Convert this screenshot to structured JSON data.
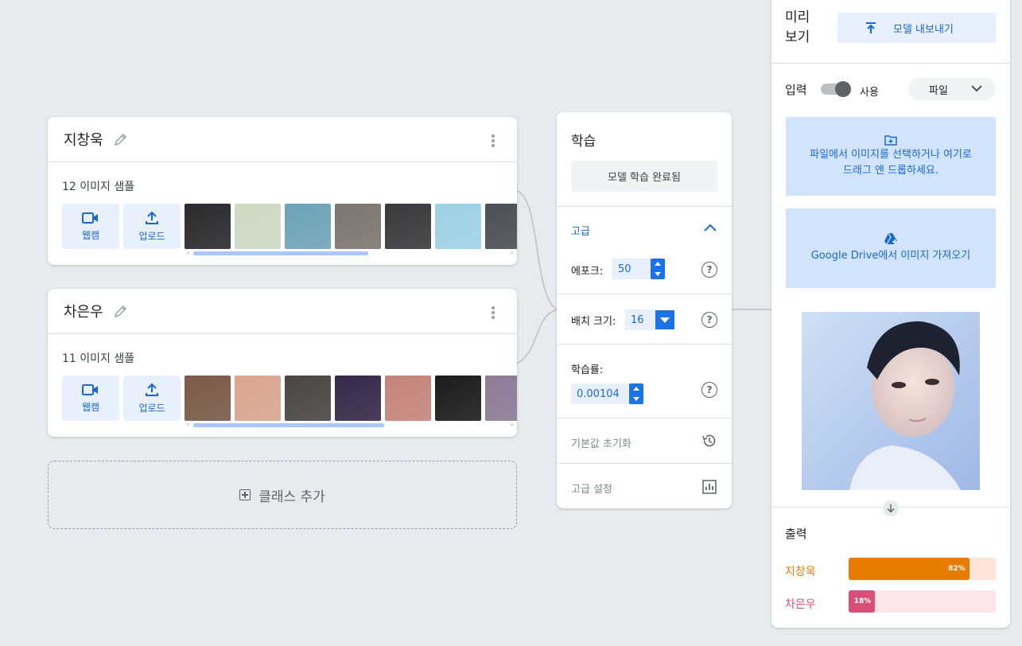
{
  "classes": [
    {
      "name": "지창욱",
      "samples_label": "12 이미지 샘플",
      "webcam_label": "웹캠",
      "upload_label": "업로드",
      "thumb_colors": [
        "#2b2b2e",
        "#cfd9c4",
        "#6fa3b8",
        "#7d7670",
        "#3a3a3c",
        "#9fd1e6",
        "#4d4f55"
      ]
    },
    {
      "name": "차은우",
      "samples_label": "11 이미지 샘플",
      "webcam_label": "웹캠",
      "upload_label": "업로드",
      "thumb_colors": [
        "#7a5a4a",
        "#d9a58f",
        "#4a4644",
        "#352a48",
        "#c4857a",
        "#1c1c1c",
        "#8c7c96"
      ]
    }
  ],
  "add_class_label": "클래스 추가",
  "training": {
    "title": "학습",
    "train_button": "모델 학습 완료됨",
    "advanced_label": "고급",
    "epochs_label": "에포크:",
    "epochs_value": "50",
    "batch_label": "배치 크기:",
    "batch_value": "16",
    "lr_label": "학습률:",
    "lr_value": "0.00104",
    "reset_label": "기본값 초기화",
    "advanced_settings_label": "고급 설정",
    "help_glyph": "?"
  },
  "preview": {
    "title": "미리보기",
    "export_label": "모델 내보내기",
    "input_label": "입력",
    "toggle_label": "사용",
    "toggle_on": true,
    "source_select": "파일",
    "file_drop_text": "파일에서 이미지를 선택하거나 여기로 드래그 앤 드롭하세요.",
    "drive_text": "Google Drive에서 이미지 가져오기",
    "output_label": "출력",
    "outputs": [
      {
        "label": "지창욱",
        "percent_text": "82%",
        "value": 0.82,
        "color": "#e67c00",
        "track_color": "#fde6d9"
      },
      {
        "label": "차은우",
        "percent_text": "18%",
        "value": 0.18,
        "color": "#d94f78",
        "track_color": "#fce4e8"
      }
    ]
  },
  "colors": {
    "accent": "#1967d2",
    "tile_bg": "#e8f0fe",
    "background": "#e8eaed"
  }
}
